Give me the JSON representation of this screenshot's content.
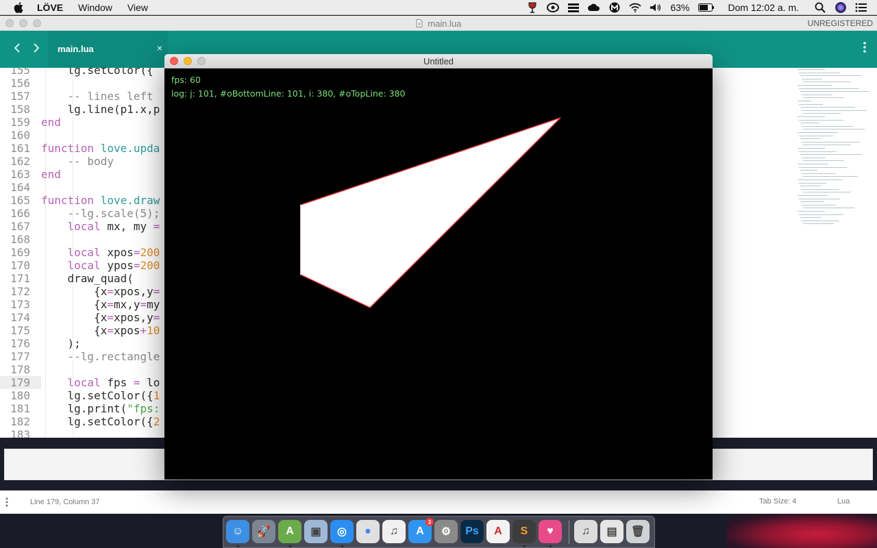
{
  "menubar": {
    "app_name": "LÖVE",
    "menus": [
      "Window",
      "View"
    ],
    "battery": "63%",
    "clock": "Dom 12:02 a. m."
  },
  "editor": {
    "window_title": "main.lua",
    "unregistered": "UNREGISTERED",
    "tab_label": "main.lua",
    "tab_close": "×",
    "current_line": 179,
    "lines": [
      {
        "n": "155",
        "html": "    <span class='txt'>lg.setColor({</span>"
      },
      {
        "n": "156",
        "html": ""
      },
      {
        "n": "157",
        "html": "    <span class='cm'>-- lines left</span>"
      },
      {
        "n": "158",
        "html": "    <span class='txt'>lg.line(p1.x,p</span>"
      },
      {
        "n": "159",
        "html": "<span class='kw'>end</span>"
      },
      {
        "n": "160",
        "html": ""
      },
      {
        "n": "161",
        "html": "<span class='kw'>function</span> <span class='fn'>love.upda</span>"
      },
      {
        "n": "162",
        "html": "    <span class='cm'>-- body</span>"
      },
      {
        "n": "163",
        "html": "<span class='kw'>end</span>"
      },
      {
        "n": "164",
        "html": ""
      },
      {
        "n": "165",
        "html": "<span class='kw'>function</span> <span class='fn'>love.draw</span>"
      },
      {
        "n": "166",
        "html": "    <span class='cm'>--lg.scale(5);</span>"
      },
      {
        "n": "167",
        "html": "    <span class='kw'>local</span> <span class='txt'>mx, my </span><span class='kw'>=</span>"
      },
      {
        "n": "168",
        "html": ""
      },
      {
        "n": "169",
        "html": "    <span class='kw'>local</span> <span class='txt'>xpos</span><span class='kw'>=</span><span class='nm'>200</span>"
      },
      {
        "n": "170",
        "html": "    <span class='kw'>local</span> <span class='txt'>ypos</span><span class='kw'>=</span><span class='nm'>200</span>"
      },
      {
        "n": "171",
        "html": "    <span class='txt'>draw_quad(</span>"
      },
      {
        "n": "172",
        "html": "        <span class='txt'>{x</span><span class='kw'>=</span><span class='txt'>xpos,y</span><span class='kw'>=</span>"
      },
      {
        "n": "173",
        "html": "        <span class='txt'>{x</span><span class='kw'>=</span><span class='txt'>mx,y</span><span class='kw'>=</span><span class='txt'>my</span>"
      },
      {
        "n": "174",
        "html": "        <span class='txt'>{x</span><span class='kw'>=</span><span class='txt'>xpos,y</span><span class='kw'>=</span>"
      },
      {
        "n": "175",
        "html": "        <span class='txt'>{x</span><span class='kw'>=</span><span class='txt'>xpos</span><span class='kw'>+</span><span class='nm'>10</span>"
      },
      {
        "n": "176",
        "html": "    <span class='txt'>);</span>"
      },
      {
        "n": "177",
        "html": "    <span class='cm'>--lg.rectangle</span>"
      },
      {
        "n": "178",
        "html": ""
      },
      {
        "n": "179",
        "html": "    <span class='kw'>local</span> <span class='txt'>fps </span><span class='kw'>=</span><span class='txt'> lo</span>"
      },
      {
        "n": "180",
        "html": "    <span class='txt'>lg.setColor({</span><span class='nm'>1</span>"
      },
      {
        "n": "181",
        "html": "    <span class='txt'>lg.print(</span><span class='st'>\"fps:</span>"
      },
      {
        "n": "182",
        "html": "    <span class='txt'>lg.setColor({</span><span class='nm'>2</span>"
      },
      {
        "n": "183",
        "html": ""
      }
    ],
    "status_position": "Line 179, Column 37",
    "status_tab_size": "Tab Size: 4",
    "status_language": "Lua"
  },
  "love_window": {
    "title": "Untitled",
    "fps_text": "fps: 60",
    "log_text": "log: j: 101, #oBottomLine: 101, i: 380, #oTopLine: 380",
    "hud_color": "#7de07d",
    "shape_fill": "#ffffff",
    "shape_outline": "#e03a3a"
  },
  "dock": {
    "apps": [
      {
        "name": "finder-icon",
        "color": "#3d8fe4",
        "glyph": "☺",
        "running": true
      },
      {
        "name": "launchpad-icon",
        "color": "#7b8794",
        "glyph": "🚀",
        "running": false
      },
      {
        "name": "android-studio-icon",
        "color": "#6aab4b",
        "glyph": "A",
        "running": true
      },
      {
        "name": "virtualbox-icon",
        "color": "#9fb8d8",
        "glyph": "▣",
        "running": false
      },
      {
        "name": "safari-icon",
        "color": "#2b8ef0",
        "glyph": "◎",
        "running": true
      },
      {
        "name": "chrome-icon",
        "color": "#e0e0e0",
        "glyph": "●",
        "running": false
      },
      {
        "name": "itunes-icon",
        "color": "#f0f0f0",
        "glyph": "♫",
        "running": false
      },
      {
        "name": "app-store-icon",
        "color": "#2f95f0",
        "glyph": "A",
        "running": false,
        "badge": "3"
      },
      {
        "name": "system-preferences-icon",
        "color": "#8a8a8a",
        "glyph": "⚙",
        "running": false
      },
      {
        "name": "photoshop-icon",
        "color": "#0b2a44",
        "glyph": "Ps",
        "running": false
      },
      {
        "name": "acrobat-icon",
        "color": "#f3f3f3",
        "glyph": "A",
        "running": false
      },
      {
        "name": "sublime-text-icon",
        "color": "#3c3c3c",
        "glyph": "S",
        "running": true
      },
      {
        "name": "love-icon",
        "color": "#e84b8a",
        "glyph": "♥",
        "running": true
      },
      {
        "name": "music-folder-icon",
        "color": "#dcdcdc",
        "glyph": "♫",
        "running": false
      },
      {
        "name": "preview-icon",
        "color": "#e6e6e6",
        "glyph": "▤",
        "running": false
      },
      {
        "name": "trash-icon",
        "color": "#cfd3d6",
        "glyph": "🗑",
        "running": false
      }
    ]
  }
}
